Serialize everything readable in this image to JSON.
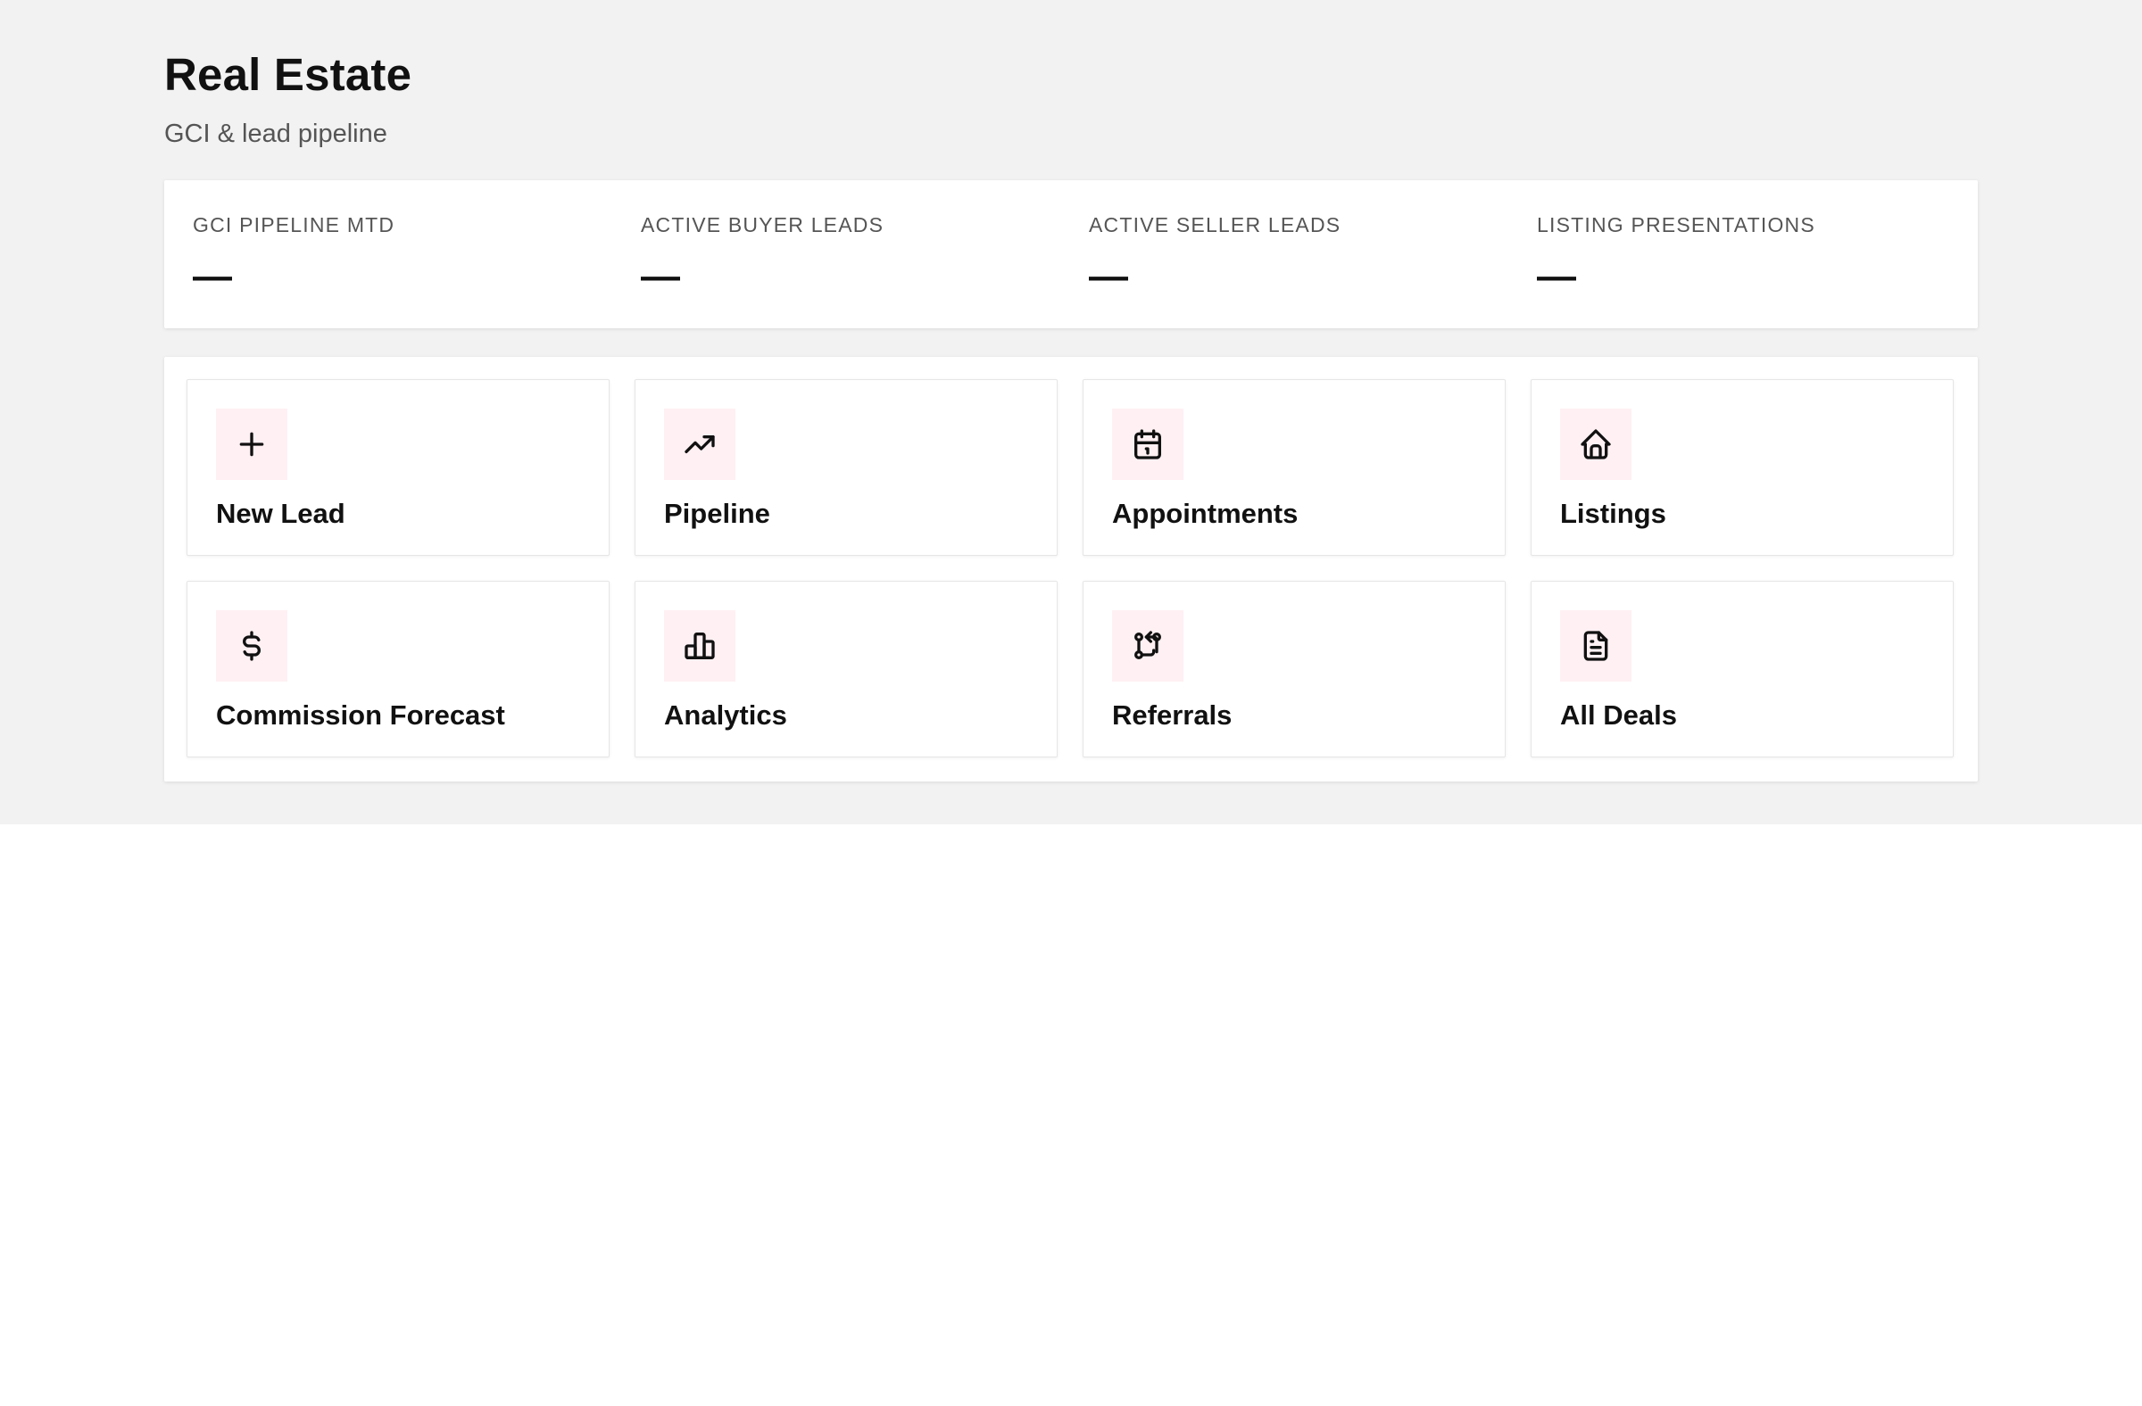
{
  "header": {
    "title": "Real Estate",
    "subtitle": "GCI & lead pipeline"
  },
  "stats": [
    {
      "label": "GCI PIPELINE MTD",
      "value": "—"
    },
    {
      "label": "ACTIVE BUYER LEADS",
      "value": "—"
    },
    {
      "label": "ACTIVE SELLER LEADS",
      "value": "—"
    },
    {
      "label": "LISTING PRESENTATIONS",
      "value": "—"
    }
  ],
  "actions": [
    {
      "label": "New Lead",
      "icon": "plus-icon"
    },
    {
      "label": "Pipeline",
      "icon": "trending-up-icon"
    },
    {
      "label": "Appointments",
      "icon": "calendar-icon"
    },
    {
      "label": "Listings",
      "icon": "house-icon"
    },
    {
      "label": "Commission Forecast",
      "icon": "dollar-icon"
    },
    {
      "label": "Analytics",
      "icon": "bar-chart-icon"
    },
    {
      "label": "Referrals",
      "icon": "git-pull-request-icon"
    },
    {
      "label": "All Deals",
      "icon": "document-icon"
    }
  ],
  "colors": {
    "page_background": "#f2f2f2",
    "card_background": "#ffffff",
    "icon_tile_background": "#fff0f3",
    "text_primary": "#111111",
    "text_secondary": "#555555"
  }
}
